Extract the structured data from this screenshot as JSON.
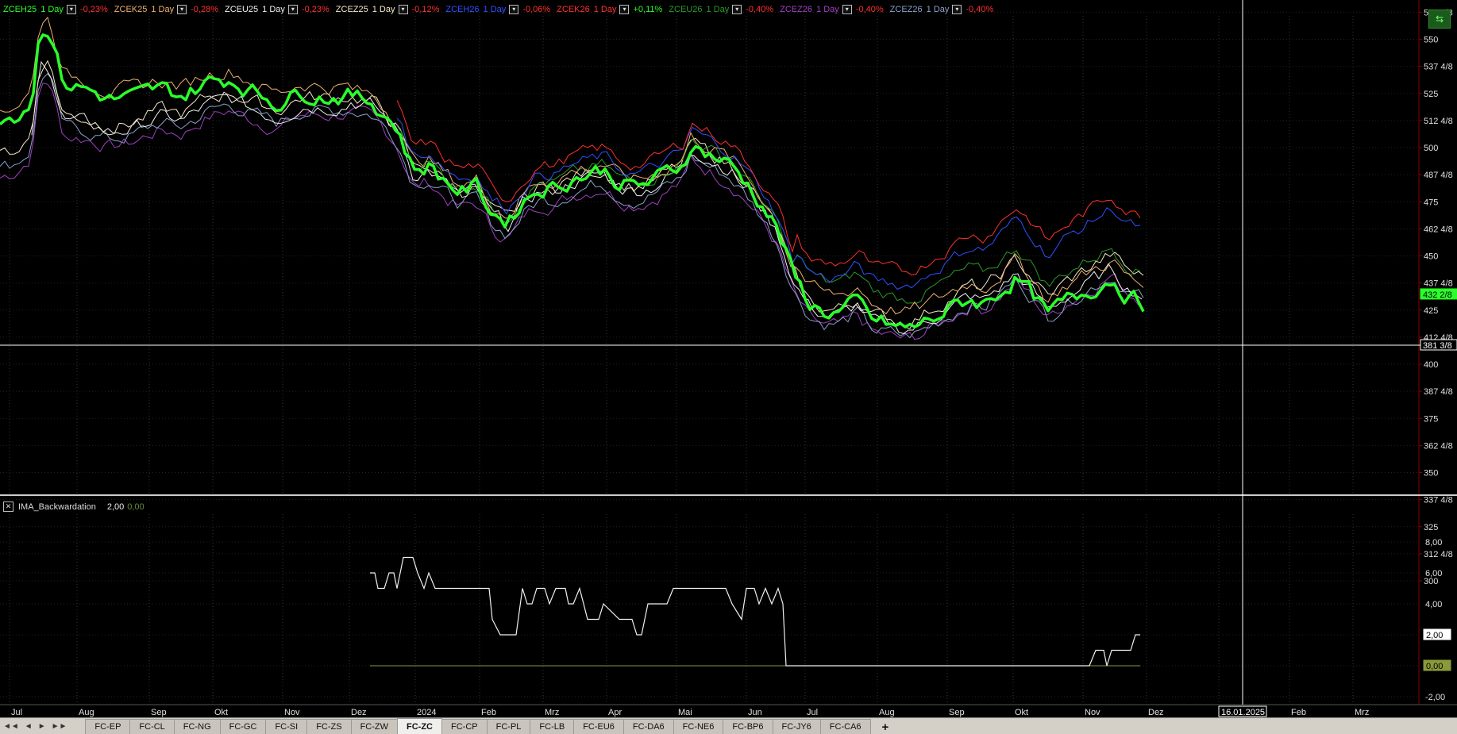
{
  "legend": [
    {
      "symbol": "ZCEH25",
      "interval": "1 Day",
      "change": "-0,23%",
      "color": "#2aff2a",
      "change_color": "#ff3030"
    },
    {
      "symbol": "ZCEK25",
      "interval": "1 Day",
      "change": "-0,28%",
      "color": "#f0b070",
      "change_color": "#ff3030"
    },
    {
      "symbol": "ZCEU25",
      "interval": "1 Day",
      "change": "-0,23%",
      "color": "#f0f0f0",
      "change_color": "#ff3030"
    },
    {
      "symbol": "ZCEZ25",
      "interval": "1 Day",
      "change": "-0,12%",
      "color": "#f5e8c8",
      "change_color": "#ff3030"
    },
    {
      "symbol": "ZCEH26",
      "interval": "1 Day",
      "change": "-0,06%",
      "color": "#3050ff",
      "change_color": "#ff3030"
    },
    {
      "symbol": "ZCEK26",
      "interval": "1 Day",
      "change": "+0,11%",
      "color": "#ff3030",
      "change_color": "#2aff2a"
    },
    {
      "symbol": "ZCEU26",
      "interval": "1 Day",
      "change": "-0,40%",
      "color": "#2a9a2a",
      "change_color": "#ff3030"
    },
    {
      "symbol": "ZCEZ26",
      "interval": "1 Day",
      "change": "-0,40%",
      "color": "#a040c0",
      "change_color": "#ff3030"
    },
    {
      "symbol": "ZCEZ26",
      "interval": "1 Day",
      "change": "-0,40%",
      "color": "#8aa0c8",
      "change_color": "#ff3030"
    }
  ],
  "price_axis": {
    "labels": [
      "562 4/8",
      "550",
      "537 4/8",
      "525",
      "512 4/8",
      "500",
      "487 4/8",
      "475",
      "462 4/8",
      "450",
      "437 4/8",
      "425",
      "412 4/8",
      "400",
      "387 4/8",
      "375",
      "362 4/8",
      "350",
      "337 4/8",
      "325",
      "312 4/8",
      "300"
    ],
    "crosshair_label": "381 3/8",
    "last_price_label": "432 2/8",
    "last_price_color": "#2aff2a"
  },
  "indicator": {
    "name": "IMA_Backwardation",
    "value": "2,00",
    "value2": "0,00",
    "axis_labels": [
      "8,00",
      "6,00",
      "4,00",
      "2,00",
      "-2,00"
    ],
    "current_label": "2,00",
    "zero_label": "0,00",
    "zero_color": "#8a9a3a"
  },
  "time_axis": {
    "labels": [
      "Jul",
      "Aug",
      "Sep",
      "Okt",
      "Nov",
      "Dez",
      "2024",
      "Feb",
      "Mrz",
      "Apr",
      "Mai",
      "Jun",
      "Jul",
      "Aug",
      "Sep",
      "Okt",
      "Nov",
      "Dez",
      "20",
      "Feb",
      "Mrz"
    ],
    "crosshair_date": "16.01.2025"
  },
  "tabs": {
    "items": [
      "FC-EP",
      "FC-CL",
      "FC-NG",
      "FC-GC",
      "FC-SI",
      "FC-ZS",
      "FC-ZW",
      "FC-ZC",
      "FC-CP",
      "FC-PL",
      "FC-LB",
      "FC-EU6",
      "FC-DA6",
      "FC-NE6",
      "FC-BP6",
      "FC-JY6",
      "FC-CA6"
    ],
    "active": "FC-ZC",
    "add_label": "+"
  },
  "nav": {
    "first": "◄◄",
    "prev": "◄",
    "next": "►",
    "last": "►►"
  }
}
